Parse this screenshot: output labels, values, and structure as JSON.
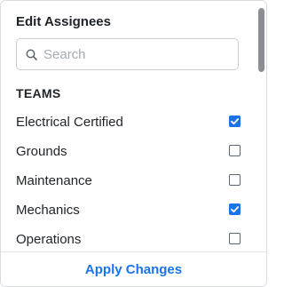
{
  "header": {
    "title": "Edit Assignees"
  },
  "search": {
    "placeholder": "Search",
    "value": "",
    "icon": "search-icon"
  },
  "teams": {
    "heading": "TEAMS",
    "items": [
      {
        "label": "Electrical Certified",
        "checked": true
      },
      {
        "label": "Grounds",
        "checked": false
      },
      {
        "label": "Maintenance",
        "checked": false
      },
      {
        "label": "Mechanics",
        "checked": true
      },
      {
        "label": "Operations",
        "checked": false
      }
    ]
  },
  "footer": {
    "apply_label": "Apply Changes"
  },
  "colors": {
    "accent": "#1a73e8",
    "text": "#1f2328",
    "placeholder": "#a4abb3"
  }
}
